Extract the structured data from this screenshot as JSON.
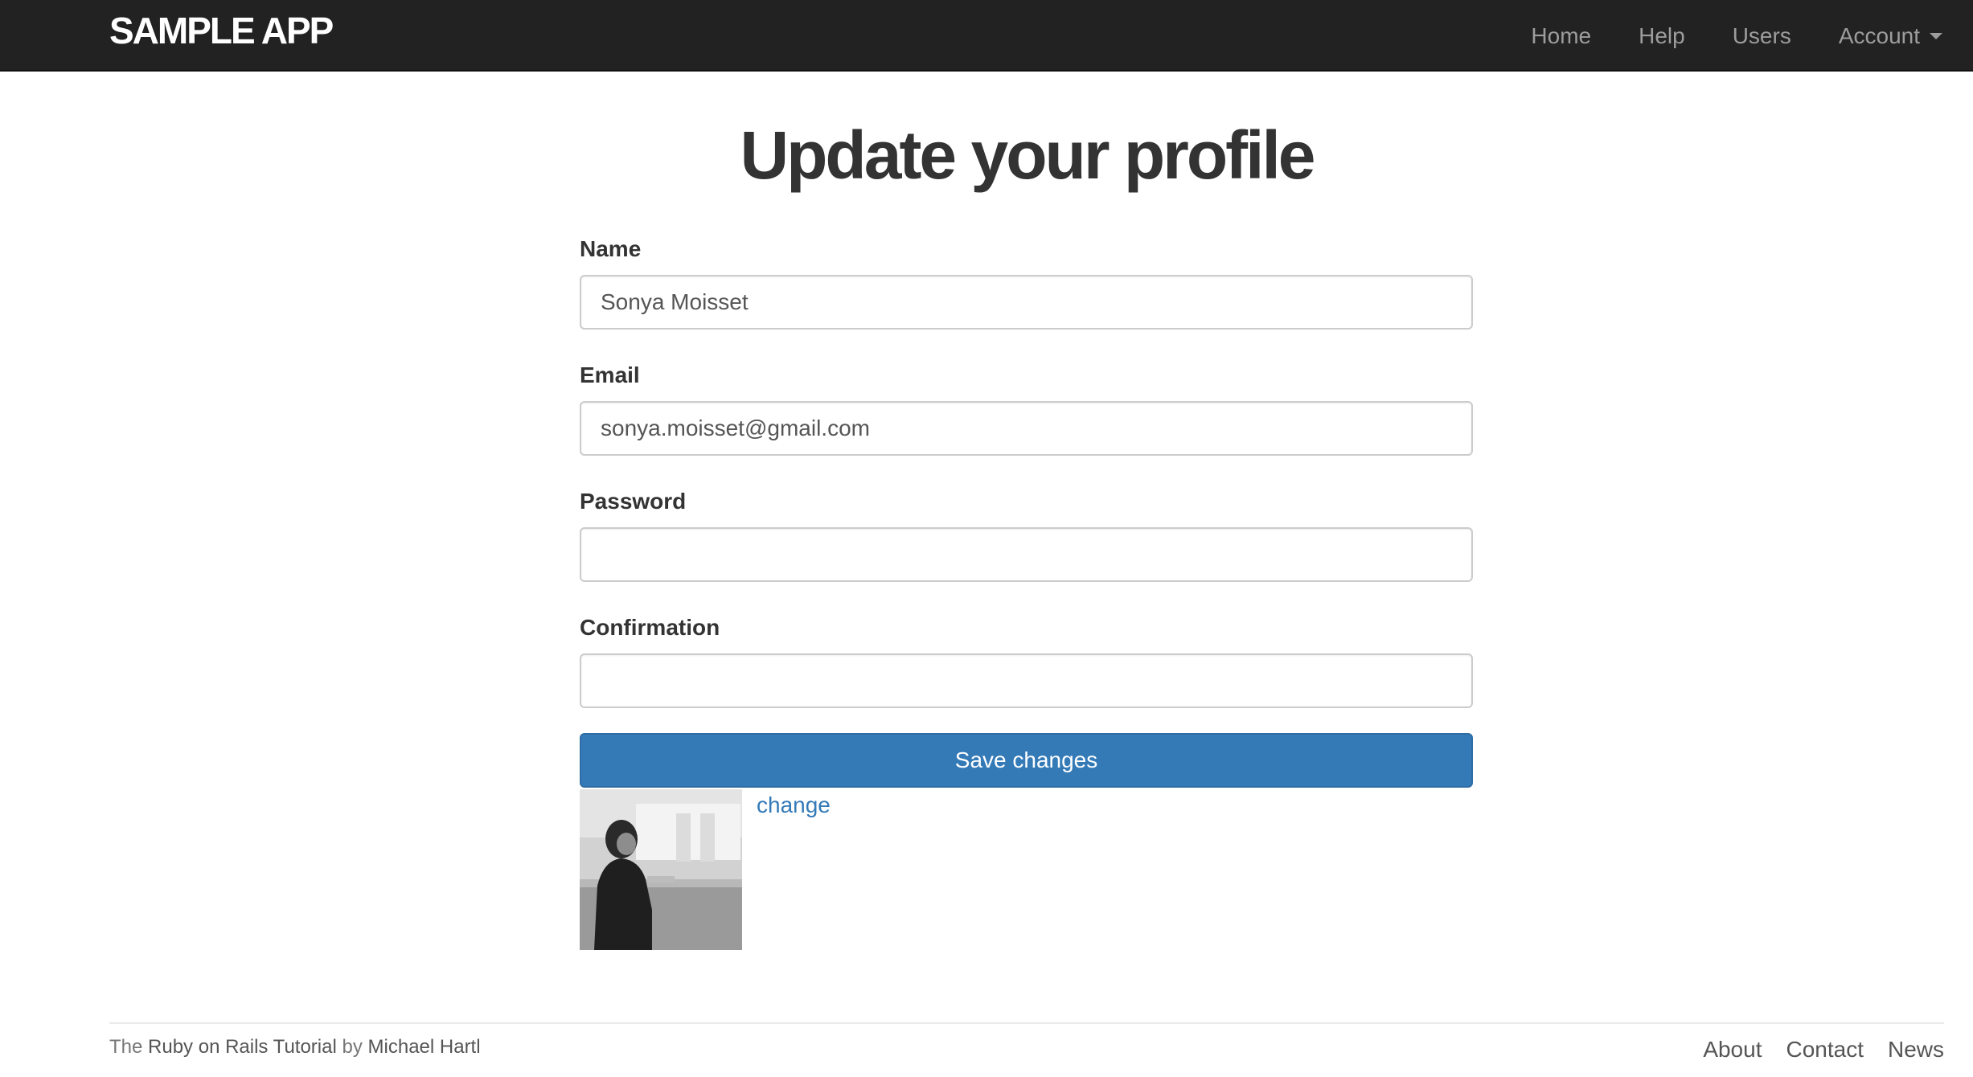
{
  "navbar": {
    "logo": "sample app",
    "links": [
      {
        "label": "Home"
      },
      {
        "label": "Help"
      },
      {
        "label": "Users"
      },
      {
        "label": "Account"
      }
    ]
  },
  "page": {
    "title": "Update your profile"
  },
  "form": {
    "name": {
      "label": "Name",
      "value": "Sonya Moisset"
    },
    "email": {
      "label": "Email",
      "value": "sonya.moisset@gmail.com"
    },
    "password": {
      "label": "Password",
      "value": ""
    },
    "confirmation": {
      "label": "Confirmation",
      "value": ""
    },
    "submit_label": "Save changes"
  },
  "gravatar": {
    "change_label": "change"
  },
  "footer": {
    "credit_prefix": "The",
    "credit_link": "Ruby on Rails Tutorial",
    "credit_by": "by",
    "credit_author": "Michael Hartl",
    "links": [
      {
        "label": "About"
      },
      {
        "label": "Contact"
      },
      {
        "label": "News"
      }
    ]
  },
  "colors": {
    "navbar_bg": "#222222",
    "primary": "#337ab7",
    "link": "#337ab7"
  }
}
